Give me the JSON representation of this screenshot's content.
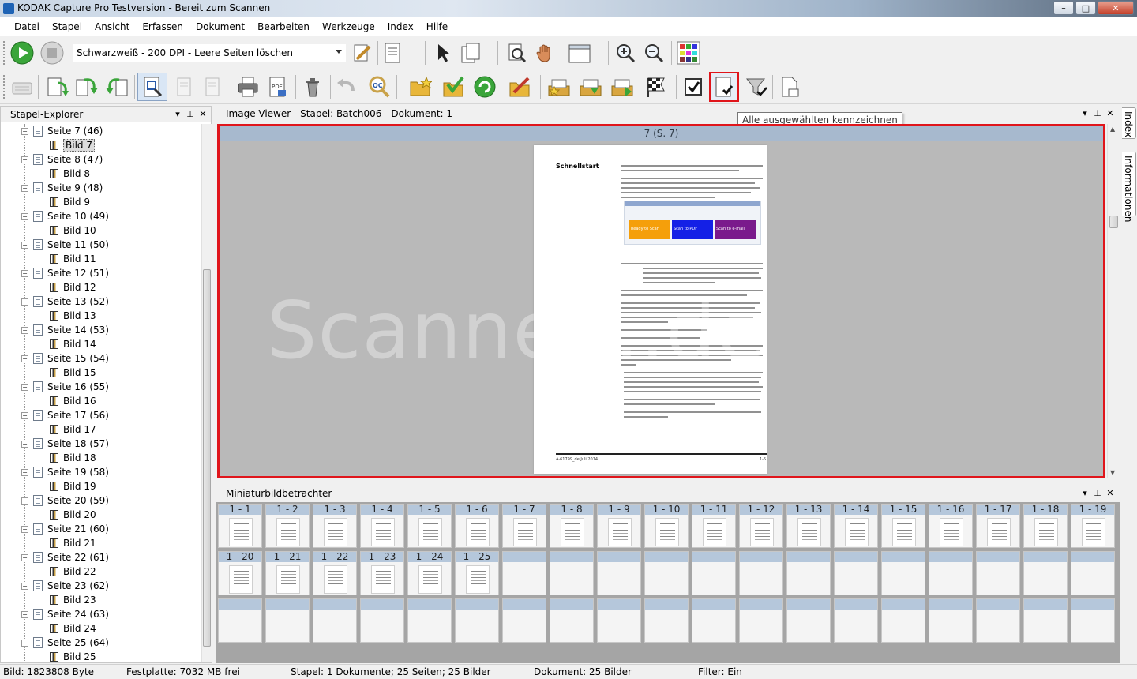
{
  "window": {
    "title": "KODAK Capture Pro Testversion - Bereit zum Scannen",
    "controls": {
      "minimize": "–",
      "maximize": "□",
      "close": "✕"
    }
  },
  "menu": [
    "Datei",
    "Stapel",
    "Ansicht",
    "Erfassen",
    "Dokument",
    "Bearbeiten",
    "Werkzeuge",
    "Index",
    "Hilfe"
  ],
  "toolbar": {
    "profile_value": "Schwarzweiß - 200 DPI - Leere Seiten löschen",
    "tooltip": "Alle ausgewählten kennzeichnen"
  },
  "explorer": {
    "title": "Stapel-Explorer",
    "rows": [
      {
        "page": "Seite 7 (46)",
        "image": "Bild 7",
        "selected": true
      },
      {
        "page": "Seite 8 (47)",
        "image": "Bild 8"
      },
      {
        "page": "Seite 9 (48)",
        "image": "Bild 9"
      },
      {
        "page": "Seite 10 (49)",
        "image": "Bild 10"
      },
      {
        "page": "Seite 11 (50)",
        "image": "Bild 11"
      },
      {
        "page": "Seite 12 (51)",
        "image": "Bild 12"
      },
      {
        "page": "Seite 13 (52)",
        "image": "Bild 13"
      },
      {
        "page": "Seite 14 (53)",
        "image": "Bild 14"
      },
      {
        "page": "Seite 15 (54)",
        "image": "Bild 15"
      },
      {
        "page": "Seite 16 (55)",
        "image": "Bild 16"
      },
      {
        "page": "Seite 17 (56)",
        "image": "Bild 17"
      },
      {
        "page": "Seite 18 (57)",
        "image": "Bild 18"
      },
      {
        "page": "Seite 19 (58)",
        "image": "Bild 19"
      },
      {
        "page": "Seite 20 (59)",
        "image": "Bild 20"
      },
      {
        "page": "Seite 21 (60)",
        "image": "Bild 21"
      },
      {
        "page": "Seite 22 (61)",
        "image": "Bild 22"
      },
      {
        "page": "Seite 23 (62)",
        "image": "Bild 23"
      },
      {
        "page": "Seite 24 (63)",
        "image": "Bild 24"
      },
      {
        "page": "Seite 25 (64)",
        "image": "Bild 25"
      }
    ]
  },
  "viewer": {
    "title": "Image Viewer - Stapel: Batch006 - Dokument: 1",
    "page_band": "7 (S. 7)",
    "watermark": "Scanner...de",
    "doc": {
      "heading": "Schnellstart",
      "buttons": [
        "Ready to Scan",
        "Scan to PDF",
        "Scan to e-mail"
      ],
      "button_colors": [
        "#f59f0b",
        "#1420e6",
        "#7a1a8c"
      ],
      "footer_left": "A-61799_de  Juli 2014",
      "footer_right": "1-5"
    }
  },
  "side_tabs": [
    "Index",
    "Informationen"
  ],
  "thumbs": {
    "title": "Miniaturbildbetrachter",
    "items": [
      "1 - 1",
      "1 - 2",
      "1 - 3",
      "1 - 4",
      "1 - 5",
      "1 - 6",
      "1 - 7",
      "1 - 8",
      "1 - 9",
      "1 - 10",
      "1 - 11",
      "1 - 12",
      "1 - 13",
      "1 - 14",
      "1 - 15",
      "1 - 16",
      "1 - 17",
      "1 - 18",
      "1 - 19",
      "1 - 20",
      "1 - 21",
      "1 - 22",
      "1 - 23",
      "1 - 24",
      "1 - 25"
    ]
  },
  "status": {
    "image_size": "Bild: 1823808 Byte",
    "disk": "Festplatte: 7032 MB frei",
    "batch": "Stapel: 1 Dokumente; 25 Seiten; 25 Bilder",
    "document": "Dokument: 25 Bilder",
    "filter": "Filter: Ein"
  }
}
